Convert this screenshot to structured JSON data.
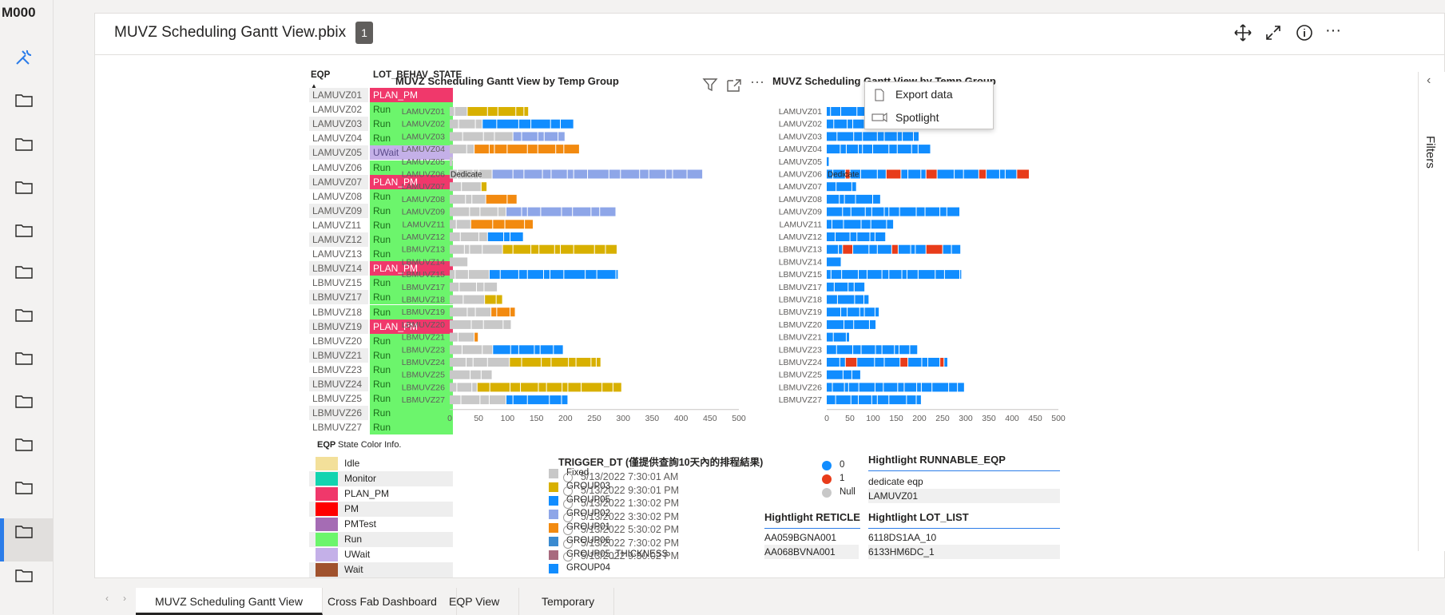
{
  "workspace": {
    "name": "M000"
  },
  "header": {
    "title": "MUVZ Scheduling Gantt View.pbix",
    "badge": "1",
    "more": "···"
  },
  "table": {
    "col1": "EQP",
    "col2": "LOT_BEHAV_STATE",
    "rows": [
      {
        "eqp": "LAMUVZ01",
        "state": "PLAN_PM",
        "color": "#f0386b"
      },
      {
        "eqp": "LAMUVZ02",
        "state": "Run",
        "color": "#6cf56c"
      },
      {
        "eqp": "LAMUVZ03",
        "state": "Run",
        "color": "#6cf56c"
      },
      {
        "eqp": "LAMUVZ04",
        "state": "Run",
        "color": "#6cf56c"
      },
      {
        "eqp": "LAMUVZ05",
        "state": "UWait",
        "color": "#c4b0e8"
      },
      {
        "eqp": "LAMUVZ06",
        "state": "Run",
        "color": "#6cf56c"
      },
      {
        "eqp": "LAMUVZ07",
        "state": "PLAN_PM",
        "color": "#f0386b"
      },
      {
        "eqp": "LAMUVZ08",
        "state": "Run",
        "color": "#6cf56c"
      },
      {
        "eqp": "LAMUVZ09",
        "state": "Run",
        "color": "#6cf56c"
      },
      {
        "eqp": "LAMUVZ11",
        "state": "Run",
        "color": "#6cf56c"
      },
      {
        "eqp": "LAMUVZ12",
        "state": "Run",
        "color": "#6cf56c"
      },
      {
        "eqp": "LAMUVZ13",
        "state": "Run",
        "color": "#6cf56c"
      },
      {
        "eqp": "LBMUVZ14",
        "state": "PLAN_PM",
        "color": "#f0386b"
      },
      {
        "eqp": "LBMUVZ15",
        "state": "Run",
        "color": "#6cf56c"
      },
      {
        "eqp": "LBMUVZ17",
        "state": "Run",
        "color": "#6cf56c"
      },
      {
        "eqp": "LBMUVZ18",
        "state": "Run",
        "color": "#6cf56c"
      },
      {
        "eqp": "LBMUVZ19",
        "state": "PLAN_PM",
        "color": "#f0386b"
      },
      {
        "eqp": "LBMUVZ20",
        "state": "Run",
        "color": "#6cf56c"
      },
      {
        "eqp": "LBMUVZ21",
        "state": "Run",
        "color": "#6cf56c"
      },
      {
        "eqp": "LBMUVZ23",
        "state": "Run",
        "color": "#6cf56c"
      },
      {
        "eqp": "LBMUVZ24",
        "state": "Run",
        "color": "#6cf56c"
      },
      {
        "eqp": "LBMUVZ25",
        "state": "Run",
        "color": "#6cf56c"
      },
      {
        "eqp": "LBMUVZ26",
        "state": "Run",
        "color": "#6cf56c"
      },
      {
        "eqp": "LBMUVZ27",
        "state": "Run",
        "color": "#6cf56c"
      }
    ]
  },
  "state_legend": {
    "col1": "EQP",
    "col2": "State Color Info.",
    "items": [
      {
        "label": "Idle",
        "color": "#f3e09a"
      },
      {
        "label": "Monitor",
        "color": "#12d4b0"
      },
      {
        "label": "PLAN_PM",
        "color": "#f0386b"
      },
      {
        "label": "PM",
        "color": "#ff0000"
      },
      {
        "label": "PMTest",
        "color": "#a56cb4"
      },
      {
        "label": "Run",
        "color": "#6cf56c"
      },
      {
        "label": "UWait",
        "color": "#c4b0e8"
      },
      {
        "label": "Wait",
        "color": "#a0522d"
      }
    ]
  },
  "chart1": {
    "title": "MUVZ Scheduling Gantt View by Temp Group",
    "xlabel": "TRIGGER_DT (僅提供查詢10天內的排程結果)",
    "dedicate_label": "Dedicate",
    "legend": [
      {
        "label": "Fixed",
        "color": "#c8c8c8"
      },
      {
        "label": "GROUP03",
        "color": "#d8b000"
      },
      {
        "label": "GROUP05",
        "color": "#118dff"
      },
      {
        "label": "GROUP02",
        "color": "#8ea6e8"
      },
      {
        "label": "GROUP01",
        "color": "#f28a10"
      },
      {
        "label": "GROUP06",
        "color": "#3a8ad0"
      },
      {
        "label": "GROUP05_THICKNESS",
        "color": "#a86a7e"
      },
      {
        "label": "GROUP04",
        "color": "#118dff"
      }
    ],
    "dates": [
      "5/13/2022 7:30:01 AM",
      "5/13/2022 9:30:01 PM",
      "5/13/2022 1:30:02 PM",
      "5/13/2022 3:30:02 PM",
      "5/13/2022 5:30:02 PM",
      "5/13/2022 7:30:02 PM",
      "5/13/2022 9:30:02 PM"
    ]
  },
  "chart2": {
    "title": "MUVZ Scheduling Gantt View by Temp Group",
    "dedicate_label": "Dedicate",
    "legend": [
      {
        "label": "0",
        "color": "#118dff"
      },
      {
        "label": "1",
        "color": "#e83c1a"
      },
      {
        "label": "Null",
        "color": "#c8c8c8"
      }
    ]
  },
  "chart_data": {
    "type": "bar",
    "categories": [
      "LAMUVZ01",
      "LAMUVZ02",
      "LAMUVZ03",
      "LAMUVZ04",
      "LAMUVZ05",
      "LAMUVZ06",
      "LAMUVZ07",
      "LAMUVZ08",
      "LAMUVZ09",
      "LAMUVZ11",
      "LAMUVZ12",
      "LBMUVZ13",
      "LBMUVZ14",
      "LBMUVZ15",
      "LBMUVZ17",
      "LBMUVZ18",
      "LBMUVZ19",
      "LBMUVZ20",
      "LBMUVZ21",
      "LBMUVZ23",
      "LBMUVZ24",
      "LBMUVZ25",
      "LBMUVZ26",
      "LBMUVZ27"
    ],
    "values": [
      137,
      215,
      200,
      225,
      6,
      438,
      65,
      117,
      288,
      145,
      128,
      290,
      32,
      292,
      83,
      92,
      114,
      107,
      50,
      197,
      262,
      74,
      298,
      205
    ],
    "xlim": [
      0,
      500
    ],
    "xticks": [
      0,
      50,
      100,
      150,
      200,
      250,
      300,
      350,
      400,
      450,
      500
    ]
  },
  "menu": {
    "export": "Export data",
    "spotlight": "Spotlight"
  },
  "slicers": {
    "runnable": {
      "title": "Hightlight RUNNABLE_EQP",
      "items": [
        "dedicate eqp",
        "LAMUVZ01"
      ]
    },
    "reticle": {
      "title": "Hightlight RETICLE",
      "items": [
        "AA059BGNA001",
        "AA068BVNA001"
      ]
    },
    "lotlist": {
      "title": "Hightlight LOT_LIST",
      "items": [
        "6118DS1AA_10",
        "6133HM6DC_1"
      ]
    }
  },
  "filters_label": "Filters",
  "tabs": [
    "MUVZ Scheduling Gantt View",
    "Cross Fab Dashboard",
    "EQP View",
    "Temporary"
  ]
}
